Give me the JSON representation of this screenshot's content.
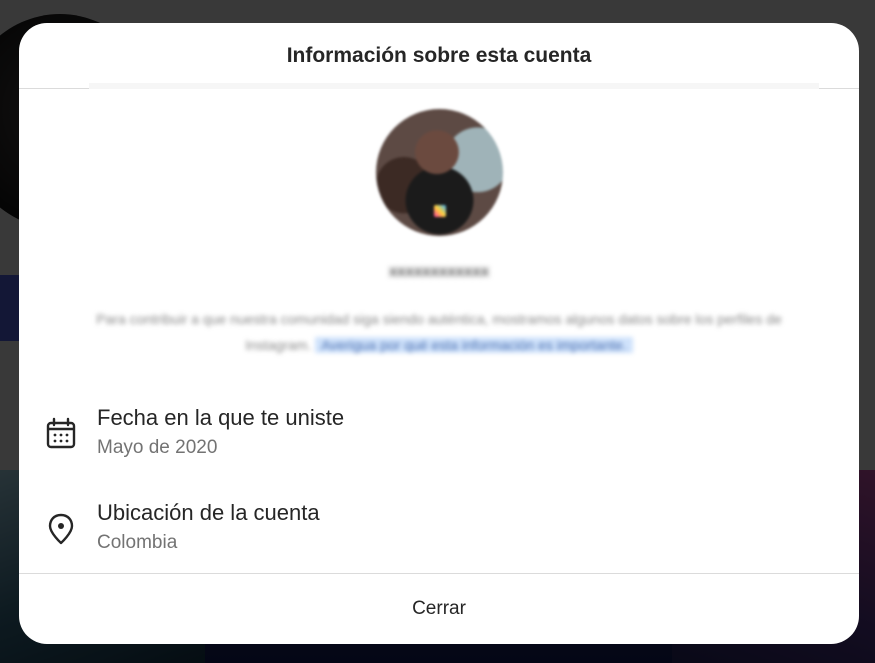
{
  "dialog": {
    "title": "Información sobre esta cuenta",
    "close_label": "Cerrar"
  },
  "profile": {
    "username": "xxxxxxxxxxxx",
    "description": "Para contribuir a que nuestra comunidad siga siendo auténtica, mostramos algunos datos sobre los perfiles de Instagram.",
    "description_link": "Averigua por qué esta información es importante."
  },
  "details": [
    {
      "label": "Fecha en la que te uniste",
      "value": "Mayo de 2020",
      "icon": "calendar-icon"
    },
    {
      "label": "Ubicación de la cuenta",
      "value": "Colombia",
      "icon": "location-pin-icon"
    }
  ],
  "colors": {
    "text_primary": "#262626",
    "text_secondary": "#737373",
    "divider": "#dbdbdb",
    "link_highlight": "#cfe2fb"
  }
}
